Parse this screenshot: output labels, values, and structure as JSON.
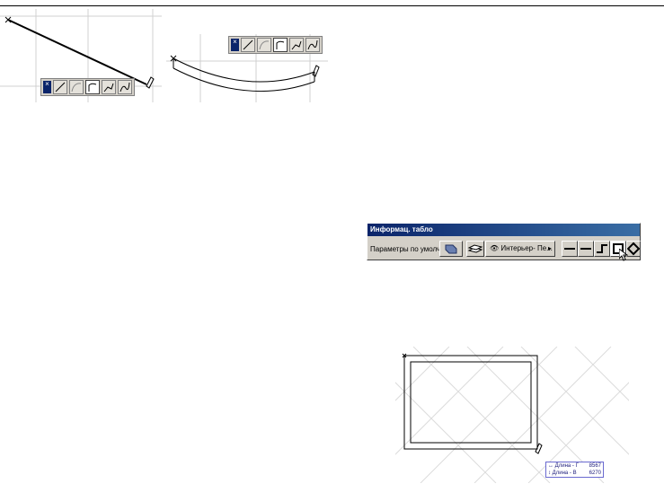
{
  "info_panel": {
    "title": "Информац. табло",
    "defaults_label": "Параметры по умолч.",
    "layer_value": "Интерьер- Пе..."
  },
  "dimensions": {
    "width_label": "Длина - Г",
    "width_value": "8567",
    "height_label": "Длина - В",
    "height_value": "6270"
  },
  "icons": {
    "close": "close-icon",
    "straight": "straight-line-icon",
    "arc": "arc-icon",
    "tangent": "tangent-arc-icon",
    "polyline": "polyline-icon",
    "spline": "spline-icon",
    "pencil": "pencil-cursor-icon",
    "eye": "eye-icon",
    "arrow_pointer": "arrow-pointer-icon"
  },
  "colors": {
    "toolbar": "#d4d0c8",
    "titlebar": "#0a246a",
    "grid": "#c8c8c8",
    "dim_text": "#1a1a7a"
  }
}
